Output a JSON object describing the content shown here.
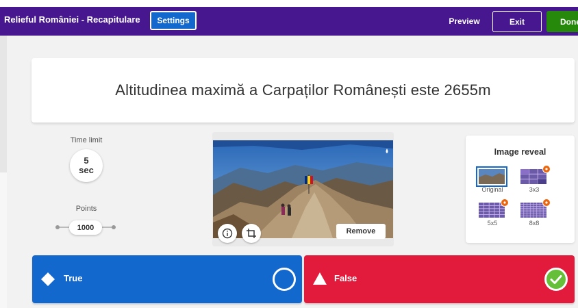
{
  "topbar": {
    "title": "Relieful României - Recapitulare",
    "settings_label": "Settings",
    "preview_label": "Preview",
    "exit_label": "Exit",
    "done_label": "Done",
    "bg_color": "#46178f"
  },
  "question": {
    "text": "Altitudinea maximă a Carpaților Românești este 2655m"
  },
  "time_limit": {
    "label": "Time limit",
    "value": "5",
    "unit": "sec"
  },
  "points": {
    "label": "Points",
    "value": "1000"
  },
  "media": {
    "remove_label": "Remove",
    "info_icon": "info-icon",
    "crop_icon": "crop-icon"
  },
  "image_reveal": {
    "title": "Image reveal",
    "options": [
      {
        "label": "Original",
        "selected": true,
        "premium": false
      },
      {
        "label": "3x3",
        "selected": false,
        "premium": true
      },
      {
        "label": "5x5",
        "selected": false,
        "premium": true
      },
      {
        "label": "8x8",
        "selected": false,
        "premium": true
      }
    ]
  },
  "answers": [
    {
      "label": "True",
      "shape": "diamond-icon",
      "color": "#1368ce",
      "correct": false
    },
    {
      "label": "False",
      "shape": "triangle-icon",
      "color": "#e21b3c",
      "correct": true
    }
  ]
}
